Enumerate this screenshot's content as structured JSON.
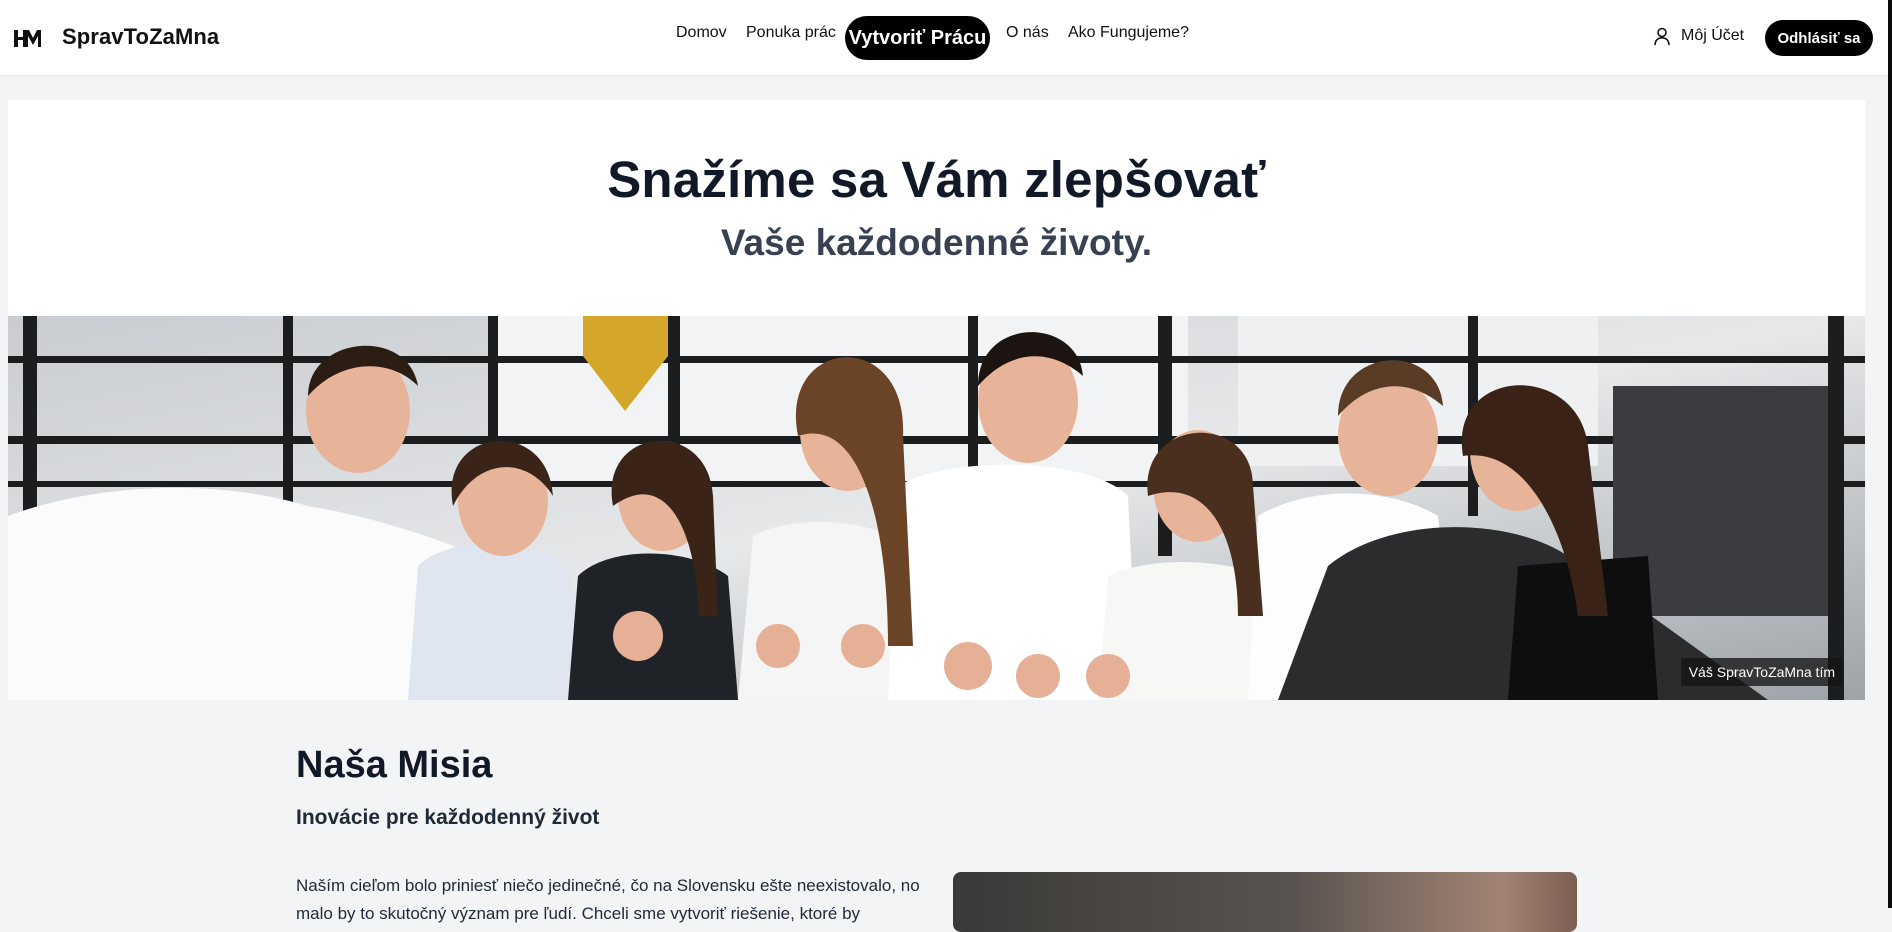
{
  "header": {
    "brand": "SpravToZaMna",
    "logo_icon": "hm-monogram-logo",
    "nav": [
      {
        "label": "Domov"
      },
      {
        "label": "Ponuka prác"
      },
      {
        "label": "Vytvoriť Prácu"
      },
      {
        "label": "O nás"
      },
      {
        "label": "Ako Fungujeme?"
      }
    ],
    "account_label": "Môj Účet",
    "account_icon": "user-icon",
    "logout_label": "Odhlásiť sa"
  },
  "hero": {
    "title": "Snažíme sa Vám zlepšovať",
    "subtitle": "Vaše každodenné životy."
  },
  "team_photo": {
    "caption": "Váš SpravToZaMna tím"
  },
  "mission": {
    "title": "Naša Misia",
    "subtitle": "Inovácie pre každodenný život",
    "text": "Naším cieľom bolo priniesť niečo jedinečné, čo na Slovensku ešte neexistovalo, no malo by to skutočný význam pre ľudí. Chceli sme vytvoriť riešenie, ktoré by"
  },
  "colors": {
    "accent": "#000000",
    "page_background": "#f3f4f6",
    "card_background": "#ffffff",
    "title": "#111827",
    "subtitle": "#374151"
  }
}
